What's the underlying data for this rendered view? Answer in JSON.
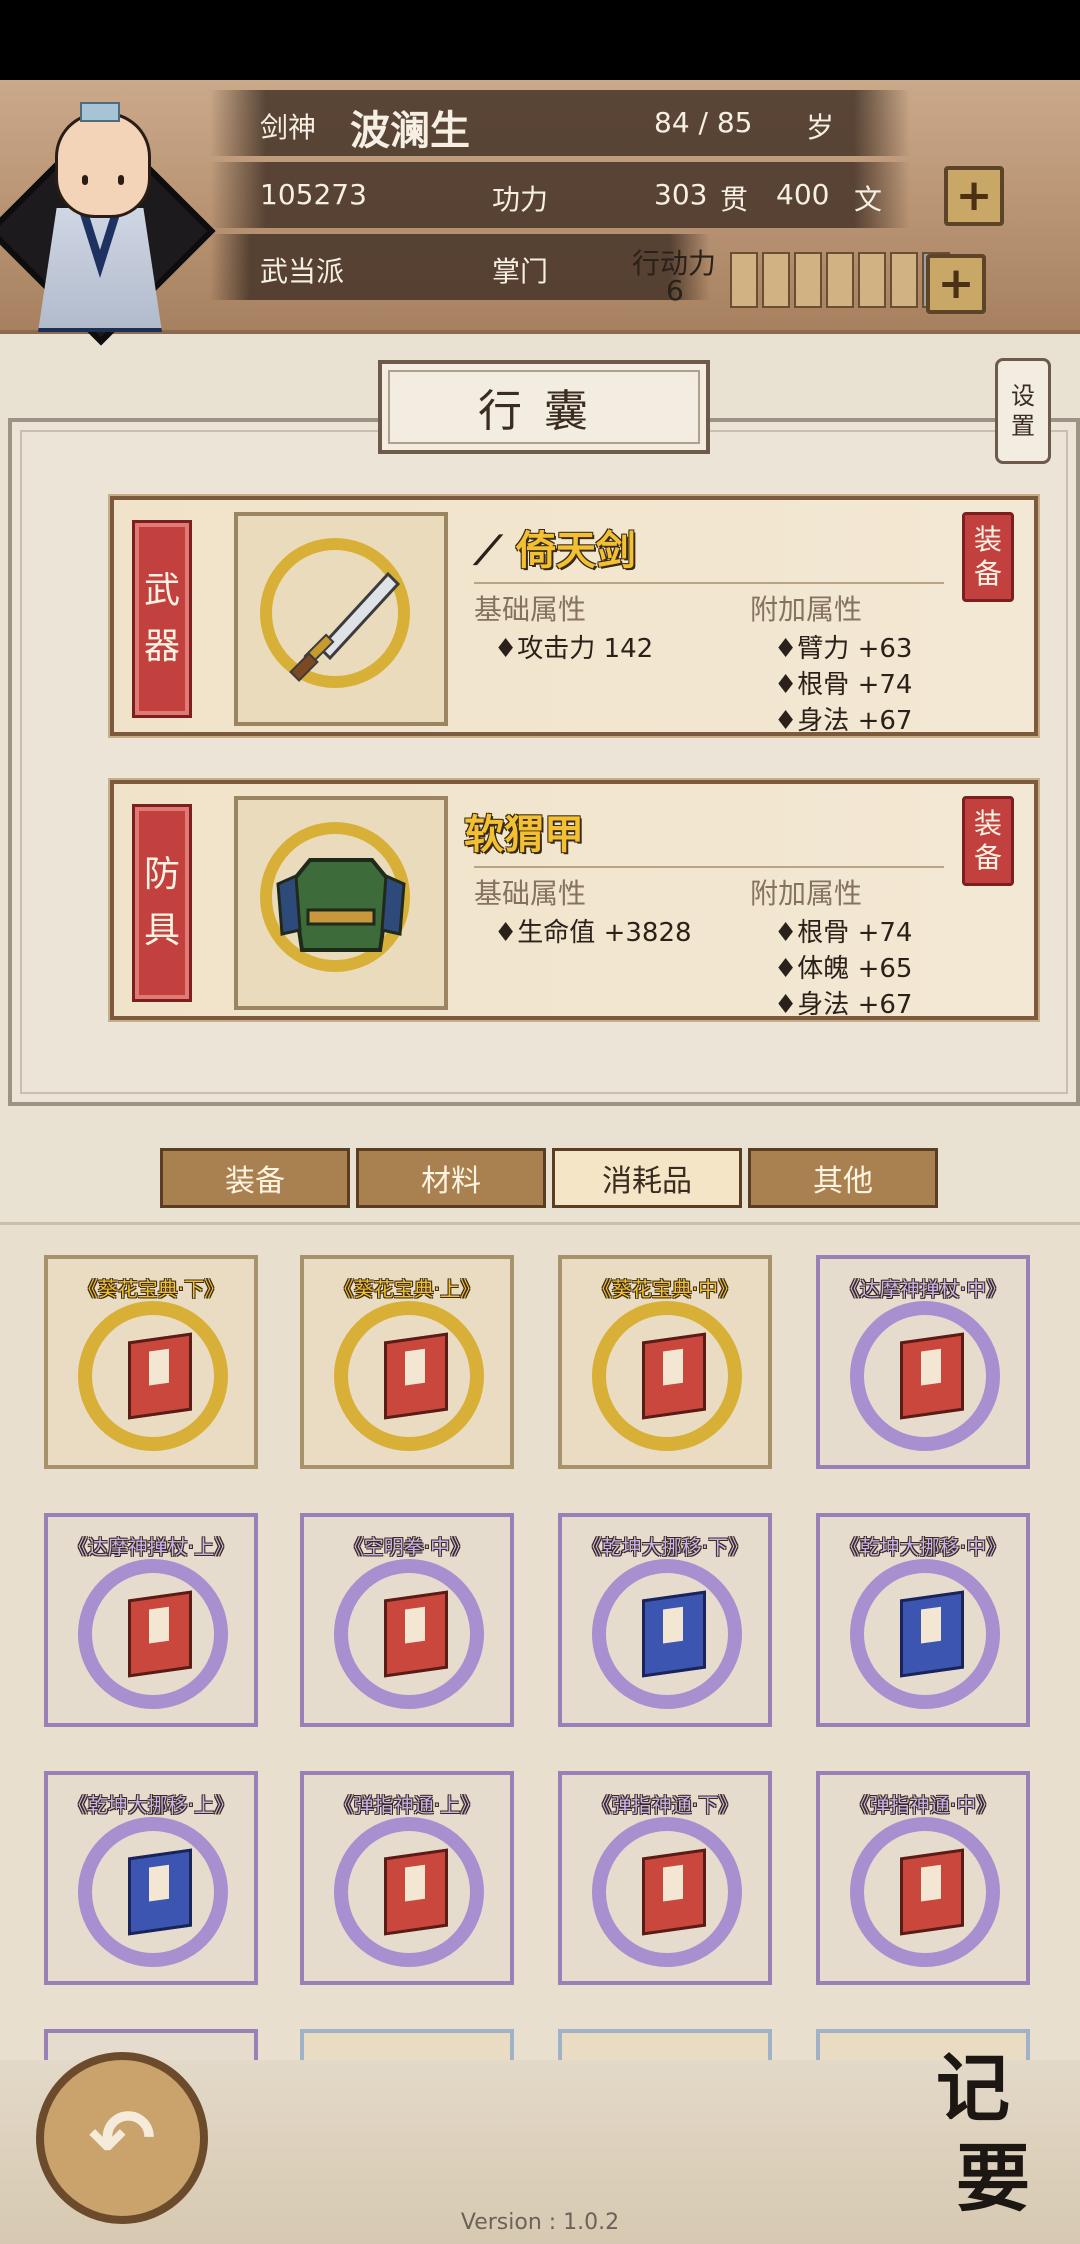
{
  "header": {
    "title": "剑神",
    "name": "波澜生",
    "age": "84 / 85",
    "age_unit": "岁",
    "power_value": "105273",
    "power_label": "功力",
    "money_guan": "303",
    "money_guan_unit": "贯",
    "money_wen": "400",
    "money_wen_unit": "文",
    "sect": "武当派",
    "role": "掌门",
    "stamina_label": "行动力",
    "stamina_value": "6",
    "stamina_filled": 6,
    "stamina_total": 7,
    "plus_label": "+"
  },
  "panel": {
    "title": "行囊",
    "settings_l1": "设",
    "settings_l2": "置"
  },
  "equipment": {
    "weapon": {
      "slot_l1": "武",
      "slot_l2": "器",
      "name": "倚天剑",
      "base_head": "基础属性",
      "extra_head": "附加属性",
      "base": [
        "♦攻击力 142"
      ],
      "extra": [
        "♦臂力 +63",
        "♦根骨 +74",
        "♦身法 +67"
      ],
      "btn_l1": "装",
      "btn_l2": "备"
    },
    "armor": {
      "slot_l1": "防",
      "slot_l2": "具",
      "name": "软猬甲",
      "base_head": "基础属性",
      "extra_head": "附加属性",
      "base": [
        "♦生命值 +3828"
      ],
      "extra": [
        "♦根骨 +74",
        "♦体魄 +65",
        "♦身法 +67"
      ],
      "btn_l1": "装",
      "btn_l2": "备"
    }
  },
  "tabs": [
    "装备",
    "材料",
    "消耗品",
    "其他"
  ],
  "active_tab": 2,
  "inventory": [
    {
      "name": "《葵花宝典·下》",
      "rarity": "gold",
      "book": "red"
    },
    {
      "name": "《葵花宝典·上》",
      "rarity": "gold",
      "book": "red"
    },
    {
      "name": "《葵花宝典·中》",
      "rarity": "gold",
      "book": "red"
    },
    {
      "name": "《达摩神掸杖·中》",
      "rarity": "purple",
      "book": "red"
    },
    {
      "name": "《达摩神掸杖·上》",
      "rarity": "purple",
      "book": "red"
    },
    {
      "name": "《空明拳·中》",
      "rarity": "purple",
      "book": "red"
    },
    {
      "name": "《乾坤大挪移·下》",
      "rarity": "purple",
      "book": "blue"
    },
    {
      "name": "《乾坤大挪移·中》",
      "rarity": "purple",
      "book": "blue"
    },
    {
      "name": "《乾坤大挪移·上》",
      "rarity": "purple",
      "book": "blue"
    },
    {
      "name": "《弹指神通·上》",
      "rarity": "purple",
      "book": "red"
    },
    {
      "name": "《弹指神通·下》",
      "rarity": "purple",
      "book": "red"
    },
    {
      "name": "《弹指神通·中》",
      "rarity": "purple",
      "book": "red"
    }
  ],
  "bottom": {
    "back_icon": "↶",
    "journal_l1": "记",
    "journal_l2": "要",
    "version": "Version : 1.0.2"
  },
  "colors": {
    "accent_red": "#c2403e",
    "gold_text": "#f2c031",
    "purple_rarity": "#9980b6",
    "gold_rarity": "#d9b037"
  }
}
